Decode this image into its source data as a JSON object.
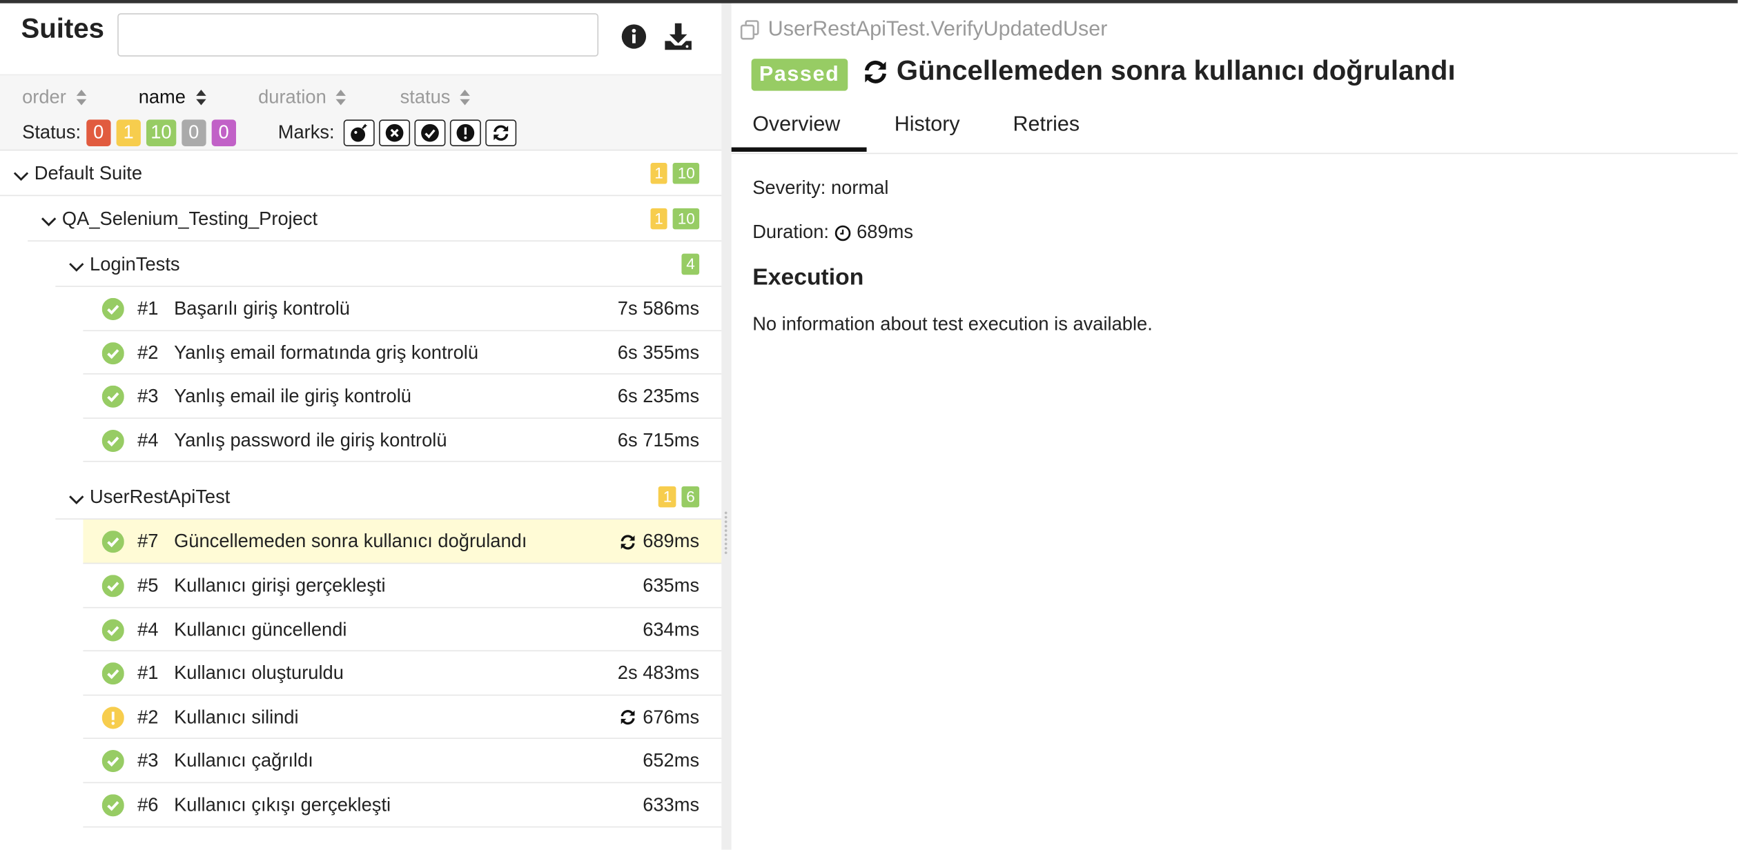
{
  "sidebar": {
    "title": "Suites",
    "search": {
      "value": "",
      "placeholder": ""
    },
    "sort_fields": [
      "order",
      "name",
      "duration",
      "status"
    ],
    "active_sort": "name",
    "status_label": "Status:",
    "status_counts": [
      {
        "status": "failed",
        "count": "0",
        "color": "#e15b3f"
      },
      {
        "status": "broken",
        "count": "1",
        "color": "#f7cd4d"
      },
      {
        "status": "passed",
        "count": "10",
        "color": "#97cc64"
      },
      {
        "status": "skipped",
        "count": "0",
        "color": "#aaaaaa"
      },
      {
        "status": "unknown",
        "count": "0",
        "color": "#c161c7"
      }
    ],
    "marks_label": "Marks:",
    "marks": [
      "flaky-bomb-icon",
      "new-failed-icon",
      "new-passed-icon",
      "new-broken-icon",
      "retries-icon"
    ]
  },
  "tree": {
    "root": {
      "name": "Default Suite",
      "counts": [
        "1",
        "10"
      ]
    },
    "project": {
      "name": "QA_Selenium_Testing_Project",
      "counts": [
        "1",
        "10"
      ]
    },
    "groups": [
      {
        "name": "LoginTests",
        "counts": [
          "",
          "4"
        ],
        "cases": [
          {
            "num": "#1",
            "name": "Başarılı giriş kontrolü",
            "duration": "7s 586ms",
            "status": "passed",
            "retried": false,
            "selected": false
          },
          {
            "num": "#2",
            "name": "Yanlış email formatında griş kontrolü",
            "duration": "6s 355ms",
            "status": "passed",
            "retried": false,
            "selected": false
          },
          {
            "num": "#3",
            "name": "Yanlış email ile giriş kontrolü",
            "duration": "6s 235ms",
            "status": "passed",
            "retried": false,
            "selected": false
          },
          {
            "num": "#4",
            "name": "Yanlış password ile giriş kontrolü",
            "duration": "6s 715ms",
            "status": "passed",
            "retried": false,
            "selected": false
          }
        ]
      },
      {
        "name": "UserRestApiTest",
        "counts": [
          "1",
          "6"
        ],
        "cases": [
          {
            "num": "#7",
            "name": "Güncellemeden sonra kullanıcı doğrulandı",
            "duration": "689ms",
            "status": "passed",
            "retried": true,
            "selected": true
          },
          {
            "num": "#5",
            "name": "Kullanıcı girişi gerçekleşti",
            "duration": "635ms",
            "status": "passed",
            "retried": false,
            "selected": false
          },
          {
            "num": "#4",
            "name": "Kullanıcı güncellendi",
            "duration": "634ms",
            "status": "passed",
            "retried": false,
            "selected": false
          },
          {
            "num": "#1",
            "name": "Kullanıcı oluşturuldu",
            "duration": "2s 483ms",
            "status": "passed",
            "retried": false,
            "selected": false
          },
          {
            "num": "#2",
            "name": "Kullanıcı silindi",
            "duration": "676ms",
            "status": "broken",
            "retried": true,
            "selected": false
          },
          {
            "num": "#3",
            "name": "Kullanıcı çağrıldı",
            "duration": "652ms",
            "status": "passed",
            "retried": false,
            "selected": false
          },
          {
            "num": "#6",
            "name": "Kullanıcı çıkışı gerçekleşti",
            "duration": "633ms",
            "status": "passed",
            "retried": false,
            "selected": false
          }
        ]
      }
    ]
  },
  "detail": {
    "path": "UserRestApiTest.VerifyUpdatedUser",
    "status_label": "Passed",
    "title": "Güncellemeden sonra kullanıcı doğrulandı",
    "tabs": [
      "Overview",
      "History",
      "Retries"
    ],
    "active_tab": "Overview",
    "severity_label": "Severity:",
    "severity_value": "normal",
    "duration_label": "Duration:",
    "duration_value": "689ms",
    "execution_heading": "Execution",
    "execution_text": "No information about test execution is available."
  }
}
